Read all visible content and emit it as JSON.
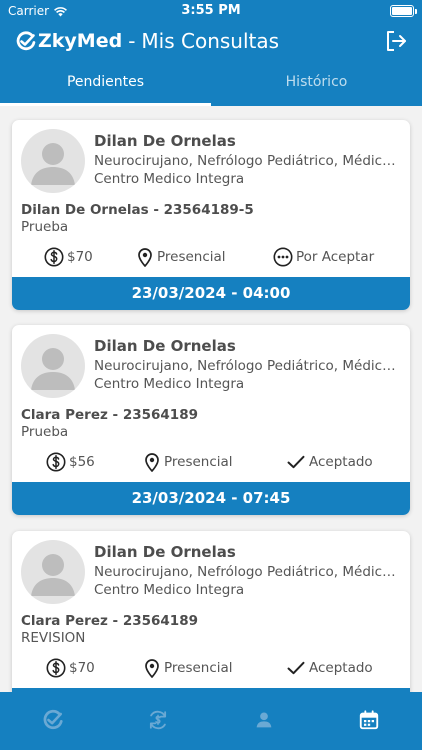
{
  "status_bar": {
    "carrier": "Carrier",
    "time": "3:55 PM"
  },
  "header": {
    "brand": "ZkyMed",
    "separator": "-",
    "title": "Mis Consultas"
  },
  "tabs": [
    {
      "label": "Pendientes",
      "active": true
    },
    {
      "label": "Histórico",
      "active": false
    }
  ],
  "appointments": [
    {
      "doctor_name": "Dilan De Ornelas",
      "specialty": "Neurocirujano, Nefrólogo Pediátrico, Médico General",
      "center": "Centro Medico Integra",
      "patient": "Dilan De Ornelas - 23564189-5",
      "reason": "Prueba",
      "price": "$70",
      "mode": "Presencial",
      "status": "Por Aceptar",
      "status_icon": "more-circle-icon",
      "datetime": "23/03/2024 - 04:00"
    },
    {
      "doctor_name": "Dilan De Ornelas",
      "specialty": "Neurocirujano, Nefrólogo Pediátrico, Médico General",
      "center": "Centro Medico Integra",
      "patient": "Clara Perez - 23564189",
      "reason": "Prueba",
      "price": "$56",
      "mode": "Presencial",
      "status": "Aceptado",
      "status_icon": "check-icon",
      "datetime": "23/03/2024 - 07:45"
    },
    {
      "doctor_name": "Dilan De Ornelas",
      "specialty": "Neurocirujano, Nefrólogo Pediátrico, Médico General",
      "center": "Centro Medico Integra",
      "patient": "Clara Perez - 23564189",
      "reason": "REVISION",
      "price": "$70",
      "mode": "Presencial",
      "status": "Aceptado",
      "status_icon": "check-icon",
      "datetime": ""
    }
  ],
  "bottom_nav": [
    {
      "icon": "zkymed-home-icon",
      "active": false
    },
    {
      "icon": "refresh-money-icon",
      "active": false
    },
    {
      "icon": "user-icon",
      "active": false
    },
    {
      "icon": "calendar-icon",
      "active": true
    }
  ],
  "colors": {
    "primary": "#1580c0",
    "inactive_icon": "#6aa9d4"
  }
}
